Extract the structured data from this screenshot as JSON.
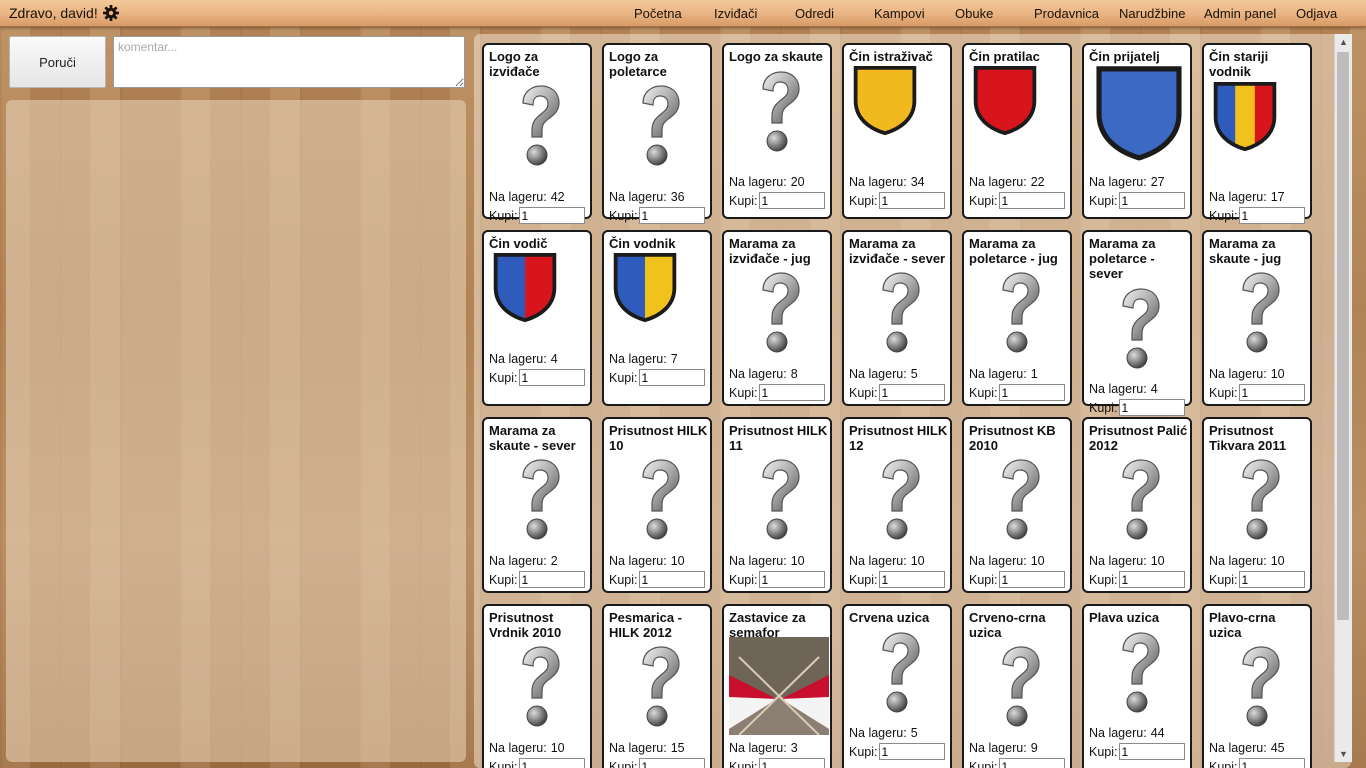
{
  "header": {
    "greeting": "Zdravo, david!",
    "nav": [
      {
        "label": "Početna",
        "name": "nav-pocetna"
      },
      {
        "label": "Izviđači",
        "name": "nav-izvidjaci"
      },
      {
        "label": "Odredi",
        "name": "nav-odredi"
      },
      {
        "label": "Kampovi",
        "name": "nav-kampovi"
      },
      {
        "label": "Obuke",
        "name": "nav-obuke"
      },
      {
        "label": "Prodavnica",
        "name": "nav-prodavnica"
      },
      {
        "label": "Narudžbine",
        "name": "nav-narudzbine"
      },
      {
        "label": "Admin panel",
        "name": "nav-admin-panel"
      },
      {
        "label": "Odjava",
        "name": "nav-odjava"
      }
    ]
  },
  "order": {
    "button_label": "Poruči",
    "comment_placeholder": "komentar..."
  },
  "labels": {
    "stock": "Na lageru:",
    "buy": "Kupi:"
  },
  "products": [
    {
      "title": "Logo za izviđače",
      "stock": "42",
      "qty": "1",
      "image": "question-mark"
    },
    {
      "title": "Logo za poletarce",
      "stock": "36",
      "qty": "1",
      "image": "question-mark"
    },
    {
      "title": "Logo za skaute",
      "stock": "20",
      "qty": "1",
      "image": "question-mark"
    },
    {
      "title": "Čin istraživač",
      "stock": "34",
      "qty": "1",
      "image": "badge",
      "colors": [
        "#f2b91e"
      ]
    },
    {
      "title": "Čin pratilac",
      "stock": "22",
      "qty": "1",
      "image": "badge",
      "colors": [
        "#d8141c"
      ]
    },
    {
      "title": "Čin prijatelj",
      "stock": "27",
      "qty": "1",
      "image": "badge",
      "colors": [
        "#3c69c4"
      ]
    },
    {
      "title": "Čin stariji vodnik",
      "stock": "17",
      "qty": "1",
      "image": "badge",
      "colors": [
        "#2f5bbd",
        "#f2c21c",
        "#d8141c"
      ]
    },
    {
      "title": "Čin vodič",
      "stock": "4",
      "qty": "1",
      "image": "badge",
      "colors": [
        "#2f5bbd",
        "#d8141c"
      ]
    },
    {
      "title": "Čin vodnik",
      "stock": "7",
      "qty": "1",
      "image": "badge",
      "colors": [
        "#2f5bbd",
        "#f2c21c"
      ]
    },
    {
      "title": "Marama za izviđače - jug",
      "stock": "8",
      "qty": "1",
      "image": "question-mark"
    },
    {
      "title": "Marama za izviđače - sever",
      "stock": "5",
      "qty": "1",
      "image": "question-mark"
    },
    {
      "title": "Marama za poletarce - jug",
      "stock": "1",
      "qty": "1",
      "image": "question-mark"
    },
    {
      "title": "Marama za poletarce - sever",
      "stock": "4",
      "qty": "1",
      "image": "question-mark"
    },
    {
      "title": "Marama za skaute - jug",
      "stock": "10",
      "qty": "1",
      "image": "question-mark"
    },
    {
      "title": "Marama za skaute - sever",
      "stock": "2",
      "qty": "1",
      "image": "question-mark"
    },
    {
      "title": "Prisutnost HILK 10",
      "stock": "10",
      "qty": "1",
      "image": "question-mark"
    },
    {
      "title": "Prisutnost HILK 11",
      "stock": "10",
      "qty": "1",
      "image": "question-mark"
    },
    {
      "title": "Prisutnost HILK 12",
      "stock": "10",
      "qty": "1",
      "image": "question-mark"
    },
    {
      "title": "Prisutnost KB 2010",
      "stock": "10",
      "qty": "1",
      "image": "question-mark"
    },
    {
      "title": "Prisutnost Palić 2012",
      "stock": "10",
      "qty": "1",
      "image": "question-mark"
    },
    {
      "title": "Prisutnost Tikvara 2011",
      "stock": "10",
      "qty": "1",
      "image": "question-mark"
    },
    {
      "title": "Prisutnost Vrdnik 2010",
      "stock": "10",
      "qty": "1",
      "image": "question-mark"
    },
    {
      "title": "Pesmarica - HILK 2012",
      "stock": "15",
      "qty": "1",
      "image": "question-mark"
    },
    {
      "title": "Zastavice za semafor",
      "stock": "3",
      "qty": "1",
      "image": "flags"
    },
    {
      "title": "Crvena uzica",
      "stock": "5",
      "qty": "1",
      "image": "question-mark"
    },
    {
      "title": "Crveno-crna uzica",
      "stock": "9",
      "qty": "1",
      "image": "question-mark"
    },
    {
      "title": "Plava uzica",
      "stock": "44",
      "qty": "1",
      "image": "question-mark"
    },
    {
      "title": "Plavo-crna uzica",
      "stock": "45",
      "qty": "1",
      "image": "question-mark"
    }
  ]
}
